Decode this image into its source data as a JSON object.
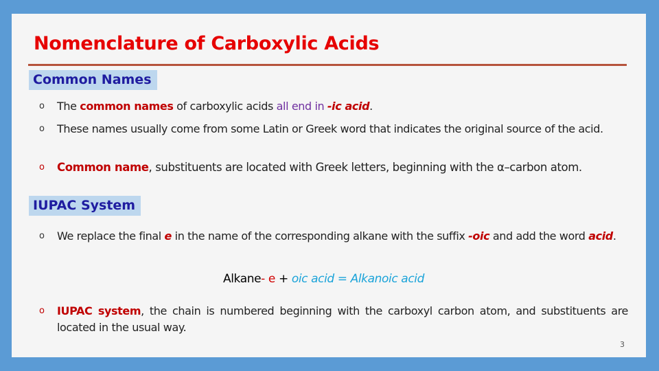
{
  "slide": {
    "title": "Nomenclature of Carboxylic Acids",
    "page_number": "3",
    "colors": {
      "background": "#5b9bd5",
      "slide": "#f5f5f5",
      "title": "#e60000",
      "rule": "#b5533c",
      "section_label_bg": "#bdd7ee",
      "section_label_text": "#1f1ca0",
      "emphasis_red": "#c00000",
      "emphasis_purple": "#7030a0",
      "formula_cyan": "#1aa3d9"
    }
  },
  "common_names": {
    "label": "Common Names",
    "bullets": [
      {
        "parts": [
          "The ",
          "common names",
          " of carboxylic acids ",
          "all end in ",
          "-ic acid",
          "."
        ]
      },
      {
        "text": "These names usually come from some Latin or Greek word that indicates the original source of the acid."
      },
      {
        "parts": [
          "Common name",
          ", substituents are located with Greek letters, beginning with the ",
          "α",
          "–carbon atom."
        ]
      }
    ]
  },
  "iupac": {
    "label": "IUPAC System",
    "bullets": [
      {
        "parts": [
          "We replace the final ",
          "e",
          " in the name of the corresponding alkane with the suffix ",
          "-oic",
          " and add the word ",
          "acid",
          "."
        ]
      },
      {
        "parts": [
          "IUPAC system",
          ", the chain is numbered beginning with the carboxyl carbon atom, and substituents are located in the usual way."
        ]
      }
    ],
    "formula": {
      "alkane": "Alkane",
      "minus_e": "- e",
      "plus": " + ",
      "rest": "oic acid = Alkanoic acid"
    }
  },
  "icons": {
    "bullet": "hollow-circle-bullet"
  }
}
